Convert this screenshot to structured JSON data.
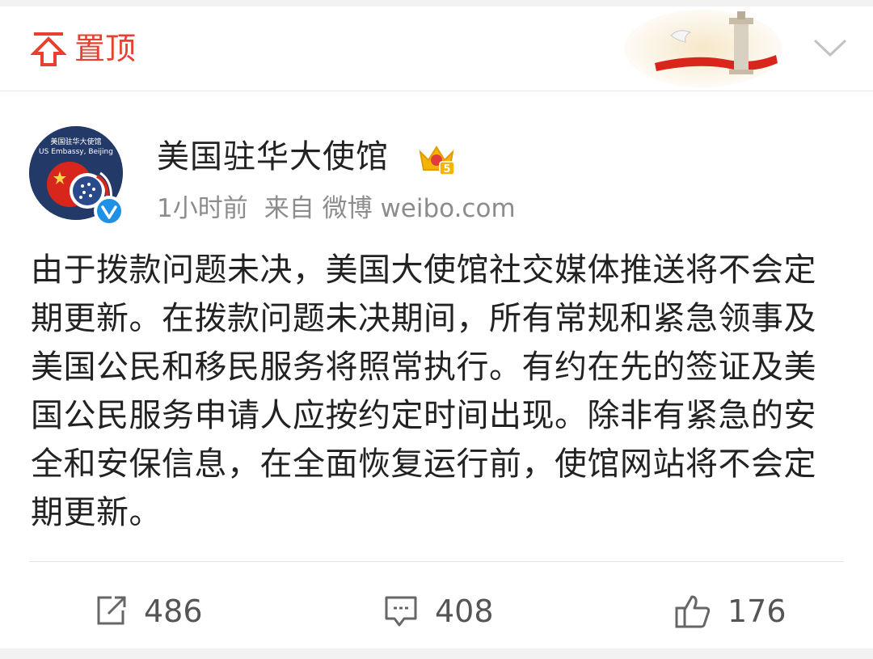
{
  "pinned": {
    "label": "置顶",
    "icon": "pin-top-icon"
  },
  "banner": {
    "icon": "celebration-banner-image"
  },
  "header_menu": {
    "icon": "chevron-down-icon"
  },
  "author": {
    "name": "美国驻华大使馆",
    "avatar_text_1": "美国驻华大使馆",
    "avatar_text_2": "US Embassy, Beijing",
    "verified_icon": "verified-v-icon",
    "vip_icon": "vip-crown-icon",
    "vip_level": "5"
  },
  "meta": {
    "time": "1小时前",
    "source": "来自 微博 weibo.com"
  },
  "post": {
    "text": "由于拨款问题未决，美国大使馆社交媒体推送将不会定期更新。在拨款问题未决期间，所有常规和紧急领事及美国公民和移民服务将照常执行。有约在先的签证及美国公民服务申请人应按约定时间出现。除非有紧急的安全和安保信息，在全面恢复运行前，使馆网站将不会定期更新。"
  },
  "actions": {
    "repost": {
      "count": "486",
      "icon": "repost-icon"
    },
    "comment": {
      "count": "408",
      "icon": "comment-icon"
    },
    "like": {
      "count": "176",
      "icon": "thumbs-up-icon"
    }
  },
  "colors": {
    "accent": "#e8402f",
    "meta": "#8c8c8c",
    "verified": "#1e90e6",
    "gold": "#f4b400"
  }
}
